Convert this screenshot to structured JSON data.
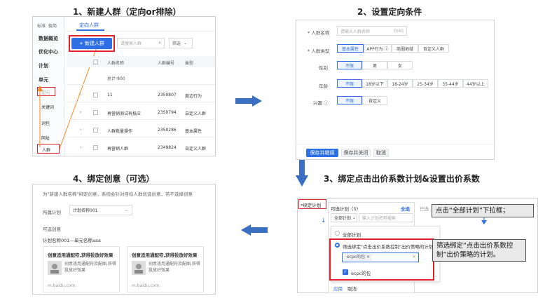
{
  "steps": {
    "s1": "1、新建人群（定向or排除）",
    "s2": "2、设置定向条件",
    "s3": "3、绑定点击出价系数计划&设置出价系数",
    "s4": "4、绑定创意（可选）"
  },
  "p1": {
    "mode_std": "标准",
    "mode_pro": "极简",
    "tab": "定向人群",
    "new_btn": "+ 新建人群",
    "search_placeholder": "请搜索人群",
    "filter": "筛选",
    "nav": [
      "数据概览",
      "优化中心",
      "计划",
      "单元",
      "定向",
      "关键词",
      "词包",
      "网址",
      "人群"
    ],
    "cols": [
      "人群名称",
      "人群编号",
      "类型"
    ],
    "rows": [
      {
        "name": "总计-800",
        "id": "",
        "type": ""
      },
      {
        "name": "11",
        "id": "2350807",
        "type": "周边行为"
      },
      {
        "name": "再营销测试有抵应",
        "id": "2350794",
        "type": "自定义人群"
      },
      {
        "name": "人群批量操作",
        "id": "2350286",
        "type": "基本属性"
      },
      {
        "name": "再营销人群",
        "id": "2349824",
        "type": "自定义人群"
      }
    ]
  },
  "p2": {
    "name_label": "* 人群名称",
    "name_placeholder": "请输入人群名称",
    "name_count": "0/40",
    "type_label": "* 人群类型",
    "types": [
      "基本属性",
      "APP行为 ⓘ",
      "商圈地域",
      "自定义人群"
    ],
    "gender_label": "性别",
    "genders": [
      "不限",
      "男",
      "女"
    ],
    "age_label": "年龄",
    "ages": [
      "不限",
      "18岁以下",
      "18-24岁",
      "25-34岁",
      "35-44岁",
      "44岁以上"
    ],
    "interest_label": "兴趣 ⓘ",
    "interests": [
      "不限",
      "自定义"
    ],
    "btn_save_next": "保存并继续",
    "btn_save_close": "保存并关闭",
    "btn_cancel": "取消"
  },
  "p3": {
    "bind_label": "*绑定计划",
    "plan_label": "可选计划（5）",
    "select_all": "全选",
    "selected": "已选",
    "dropdown": "全部计划",
    "input_placeholder": "输入计划名称搜索",
    "opt_all": "全部计划",
    "opt_filter": "筛选绑定\"点击出价系数控制\"出价策略的计划",
    "tag": "ecpc的包 ×",
    "checked_item": "ecpc的包",
    "apply": "应用",
    "cancel": "取消",
    "note1": "点击“全部计划”下拉框；",
    "note2": "筛选绑定“点击出价系数控制”出价策略的计划。"
  },
  "p4": {
    "hint": "为\"新建人群名称\"绑定创意，系统会针对目标人群优选创意，若不选择创意",
    "plan_label": "所属计划",
    "plan_value": "计划名称001",
    "creative_label": "可选创意",
    "unit_label": "计划名称001—单元名称aaa",
    "cards": [
      {
        "title": "创意适用通配符,获得投放好效果",
        "desc": "创意适用通配符及配图,获得投放好效果",
        "url": "m.baidu.com"
      },
      {
        "title": "创意适用通配符,获得投放好效果",
        "desc": "创意适用通配符及配图,获得投放好效果",
        "url": "m.baidu.com"
      }
    ]
  },
  "colors": {
    "accent": "#2f6fe6",
    "highlight": "#e0202a",
    "arrow": "#3a6fc4",
    "orange": "#f08a24"
  }
}
